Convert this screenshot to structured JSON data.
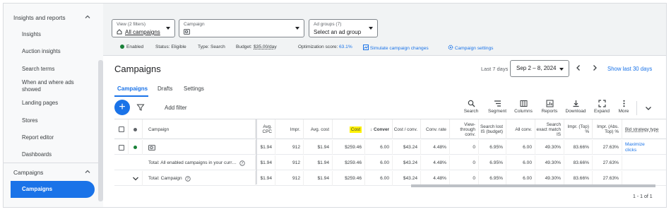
{
  "sidebar": {
    "section_insights": "Insights and reports",
    "items": [
      "Insights",
      "Auction insights",
      "Search terms",
      "When and where ads showed",
      "Landing pages",
      "Stores",
      "Report editor",
      "Dashboards"
    ],
    "section_campaigns": "Campaigns",
    "active_item": "Campaigns"
  },
  "filters": {
    "view_label": "View (2 filters)",
    "view_value": "All campaigns",
    "campaign_label": "Campaign",
    "adgroups_label": "Ad groups (7)",
    "adgroups_value": "Select an ad group"
  },
  "status": {
    "enabled": "Enabled",
    "status": "Status: Eligible",
    "type": "Type: Search",
    "budget_label": "Budget:",
    "budget_value": "$35.00/day",
    "opt_label": "Optimization score:",
    "opt_value": "63.1%",
    "simulate": "Simulate campaign changes",
    "settings": "Campaign settings"
  },
  "page": {
    "title": "Campaigns",
    "date_label": "Last 7 days",
    "date_value": "Sep 2 – 8, 2024",
    "show_30": "Show last 30 days"
  },
  "tabs": [
    "Campaigns",
    "Drafts",
    "Settings"
  ],
  "toolbar": {
    "add_filter": "Add filter",
    "tools": [
      "Search",
      "Segment",
      "Columns",
      "Reports",
      "Download",
      "Expand",
      "More"
    ]
  },
  "table": {
    "headers": {
      "campaign": "Campaign",
      "avg_cpc": "Avg. CPC",
      "impr": "Impr.",
      "avg_cost": "Avg. cost",
      "cost": "Cost",
      "conver": "Conver",
      "cost_conv": "Cost / conv.",
      "conv_rate": "Conv. rate",
      "view_through": "View-through conv.",
      "search_lost": "Search lost IS (budget)",
      "all_conv": "All conv.",
      "search_exact": "Search exact match IS",
      "impr_top": "Impr. (Top) %",
      "impr_abs_top": "Impr. (Abs. Top) %",
      "bid_strategy": "Bid strategy type"
    },
    "rows": [
      {
        "name": "",
        "avg_cpc": "$1.94",
        "impr": "912",
        "avg_cost": "$1.94",
        "cost": "$259.46",
        "conver": "6.00",
        "cost_conv": "$43.24",
        "conv_rate": "4.48%",
        "view_through": "0",
        "search_lost": "6.95%",
        "all_conv": "6.00",
        "search_exact": "49.30%",
        "impr_top": "83.66%",
        "impr_abs_top": "27.63%",
        "bid_strategy": "Maximize clicks"
      },
      {
        "name": "Total: All enabled campaigns in your curr…",
        "avg_cpc": "$1.94",
        "impr": "912",
        "avg_cost": "$1.94",
        "cost": "$259.46",
        "conver": "6.00",
        "cost_conv": "$43.24",
        "conv_rate": "4.48%",
        "view_through": "0",
        "search_lost": "6.95%",
        "all_conv": "6.00",
        "search_exact": "49.30%",
        "impr_top": "83.66%",
        "impr_abs_top": "27.63%",
        "bid_strategy": ""
      },
      {
        "name": "Total: Campaign",
        "avg_cpc": "$1.94",
        "impr": "912",
        "avg_cost": "$1.94",
        "cost": "$259.46",
        "conver": "6.00",
        "cost_conv": "$43.24",
        "conv_rate": "4.48%",
        "view_through": "0",
        "search_lost": "6.95%",
        "all_conv": "6.00",
        "search_exact": "49.30%",
        "impr_top": "83.66%",
        "impr_abs_top": "27.63%",
        "bid_strategy": ""
      }
    ],
    "pager": "1 - 1 of 1"
  },
  "colors": {
    "accent": "#1a73e8",
    "enabled": "#188038",
    "highlight": "#fff200"
  }
}
